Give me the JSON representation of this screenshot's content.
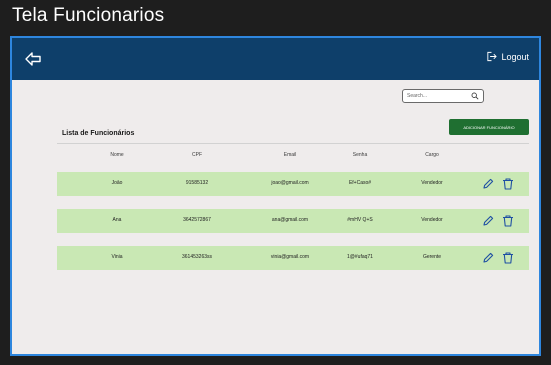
{
  "window": {
    "title": "Tela Funcionarios"
  },
  "navbar": {
    "logout_label": "Logout"
  },
  "search": {
    "placeholder": "Search..."
  },
  "add_button_label": "ADICIONAR FUNCIONÁRIO",
  "section_title": "Lista de Funcionários",
  "table": {
    "headers": [
      "Nome",
      "CPF",
      "Email",
      "Senha",
      "Cargo"
    ],
    "rows": [
      [
        "Joāo",
        "91585132",
        "joao@gmail.com",
        "Ef+Caso#",
        "Vendedor"
      ],
      [
        "Ana",
        "3642572867",
        "ana@gmail.com",
        "#mHV Q+S",
        "Vendedor"
      ],
      [
        "Vinia",
        "361453263ss",
        "vinia@gmail.com",
        "1@#ufaq71",
        "Gerente"
      ]
    ]
  },
  "colors": {
    "navbar": "#0e3f6a",
    "frame_border": "#2e86de",
    "row_background": "#c9e8b4",
    "add_button": "#1f6f31",
    "action_icon": "#1e4fa3"
  },
  "icons": {
    "back": "arrow-left-icon",
    "logout": "logout-icon",
    "search": "search-icon",
    "edit": "pencil-icon",
    "delete": "trash-icon"
  }
}
